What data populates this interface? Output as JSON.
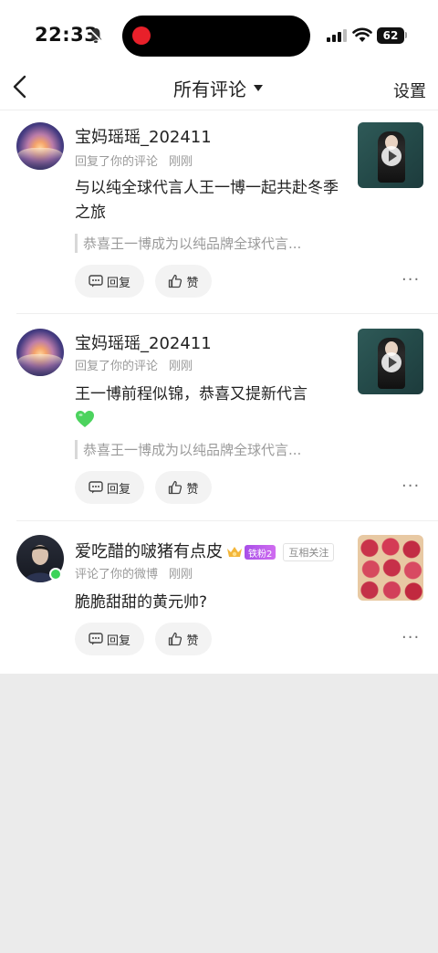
{
  "status_bar": {
    "time": "22:33",
    "battery": "62"
  },
  "nav": {
    "title": "所有评论",
    "settings_label": "设置"
  },
  "comments": [
    {
      "username": "宝妈瑶瑶_202411",
      "action": "回复了你的评论",
      "time": "刚刚",
      "text": "与以纯全球代言人王一博一起共赴冬季之旅",
      "quote": "恭喜王一博成为以纯品牌全球代言...",
      "reply_label": "回复",
      "like_label": "赞",
      "more_label": "···"
    },
    {
      "username": "宝妈瑶瑶_202411",
      "action": "回复了你的评论",
      "time": "刚刚",
      "text": "王一博前程似锦，恭喜又提新代言",
      "quote": "恭喜王一博成为以纯品牌全球代言...",
      "reply_label": "回复",
      "like_label": "赞",
      "more_label": "···"
    },
    {
      "username": "爱吃醋的啵猪有点皮",
      "fan_badge": "铁粉2",
      "mutual_tag": "互相关注",
      "action": "评论了你的微博",
      "time": "刚刚",
      "text": "脆脆甜甜的黄元帅?",
      "reply_label": "回复",
      "like_label": "赞",
      "more_label": "···"
    }
  ],
  "colors": {
    "online": "#3dd35a",
    "fan_badge": "#b45cec",
    "record": "#e8202a",
    "heart": "#4cd35e"
  }
}
